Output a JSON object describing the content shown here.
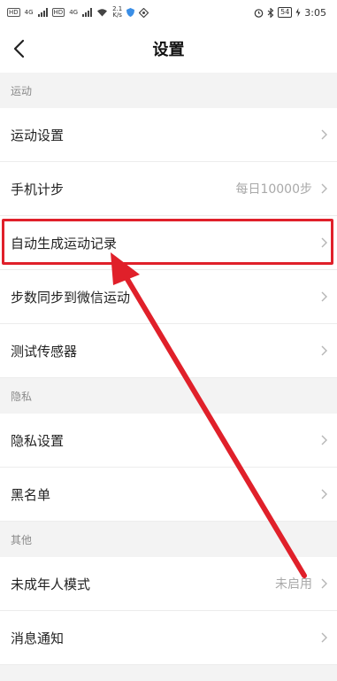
{
  "status": {
    "carrier_chip_1": "HD",
    "carrier_chip_2": "HD",
    "net1": "4G",
    "net2": "4G",
    "speed_value": "2.1",
    "speed_unit": "K/s",
    "battery": "54",
    "time": "3:05"
  },
  "header": {
    "title": "设置"
  },
  "sections": {
    "exercise": "运动",
    "privacy": "隐私",
    "other": "其他"
  },
  "rows": {
    "sport_settings": {
      "label": "运动设置"
    },
    "phone_steps": {
      "label": "手机计步",
      "value": "每日10000步"
    },
    "auto_record": {
      "label": "自动生成运动记录"
    },
    "sync_wechat": {
      "label": "步数同步到微信运动"
    },
    "test_sensor": {
      "label": "测试传感器"
    },
    "privacy_settings": {
      "label": "隐私设置"
    },
    "blacklist": {
      "label": "黑名单"
    },
    "minor_mode": {
      "label": "未成年人模式",
      "value": "未启用"
    },
    "notifications": {
      "label": "消息通知"
    }
  },
  "colors": {
    "annotation": "#e0202a",
    "background": "#f3f3f3"
  }
}
